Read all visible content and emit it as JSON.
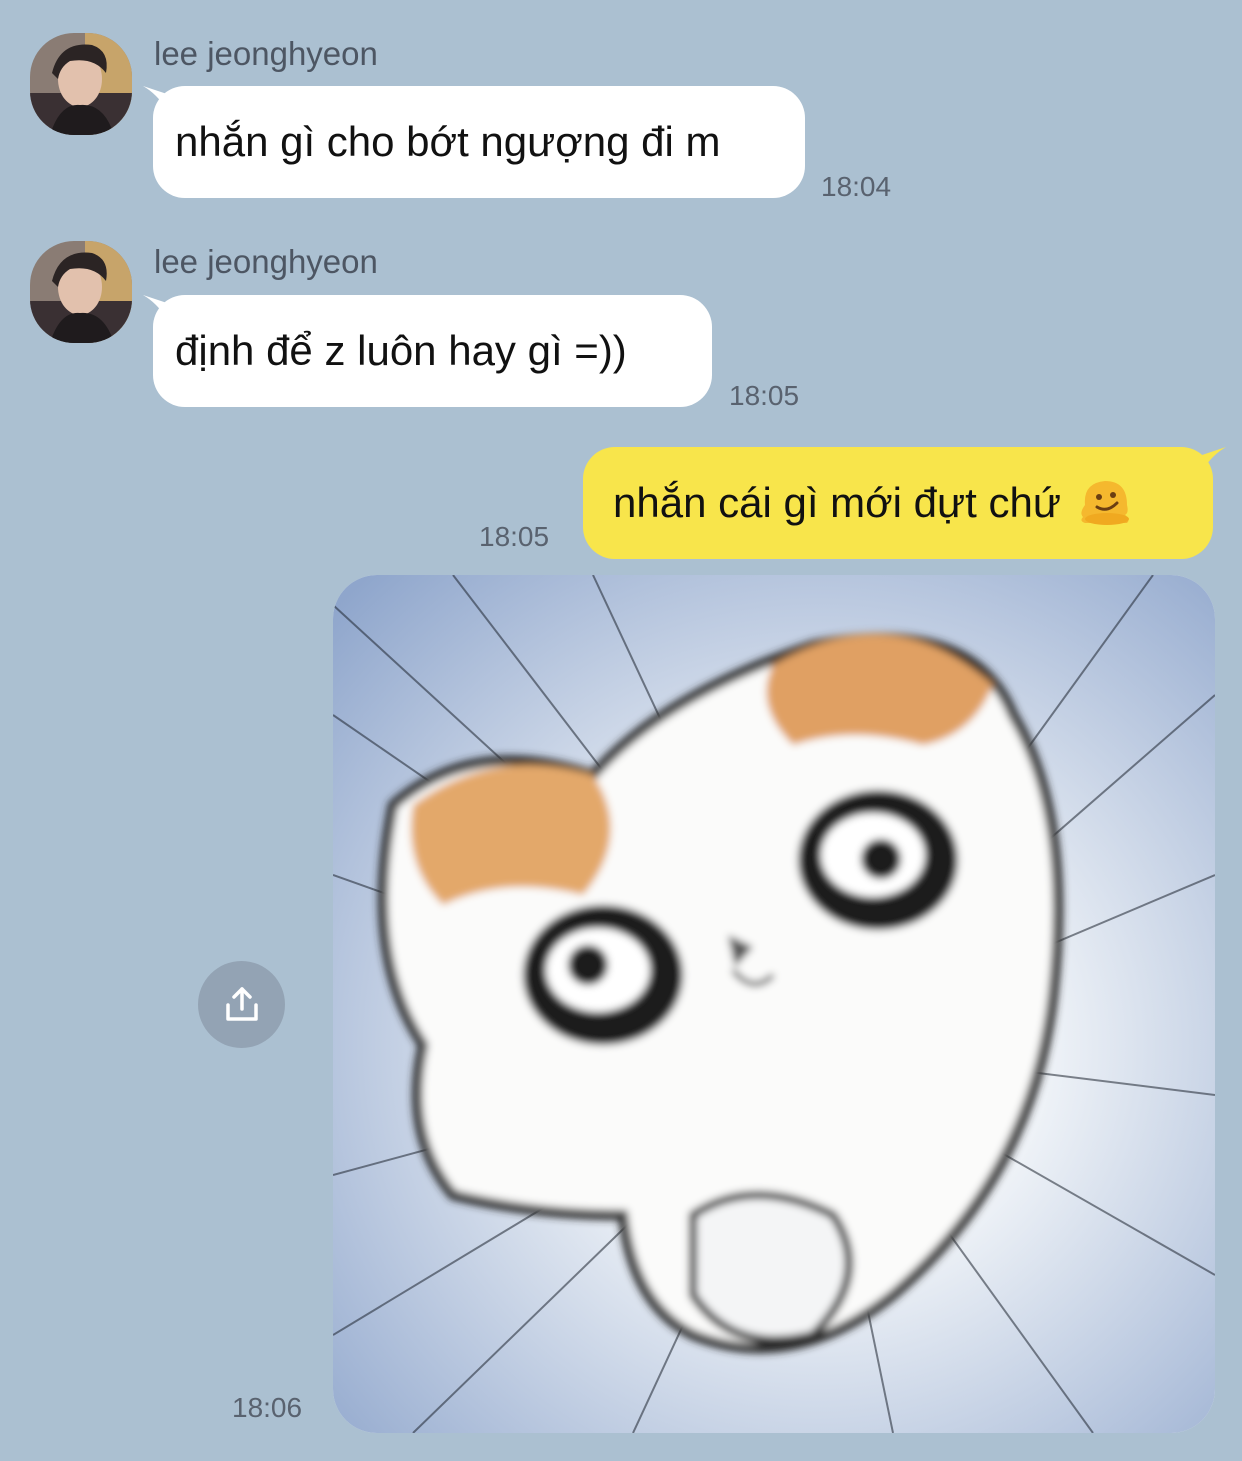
{
  "chat": {
    "messages": [
      {
        "sender": "lee jeonghyeon",
        "text": "nhắn gì cho bớt ngượng đi m",
        "time": "18:04"
      },
      {
        "sender": "lee jeonghyeon",
        "text": "định để z luôn hay gì =))",
        "time": "18:05"
      },
      {
        "text": "nhắn cái gì mới đựt chứ",
        "emoji": "melting-face-emoji",
        "time": "18:05"
      },
      {
        "image": "crying-cat-meme",
        "time": "18:06"
      }
    ]
  },
  "colors": {
    "background": "#abc0d1",
    "incoming_bubble": "#ffffff",
    "outgoing_bubble": "#f8e54b",
    "timestamp": "#59626f"
  },
  "icons": {
    "share": "share-upload-icon"
  }
}
